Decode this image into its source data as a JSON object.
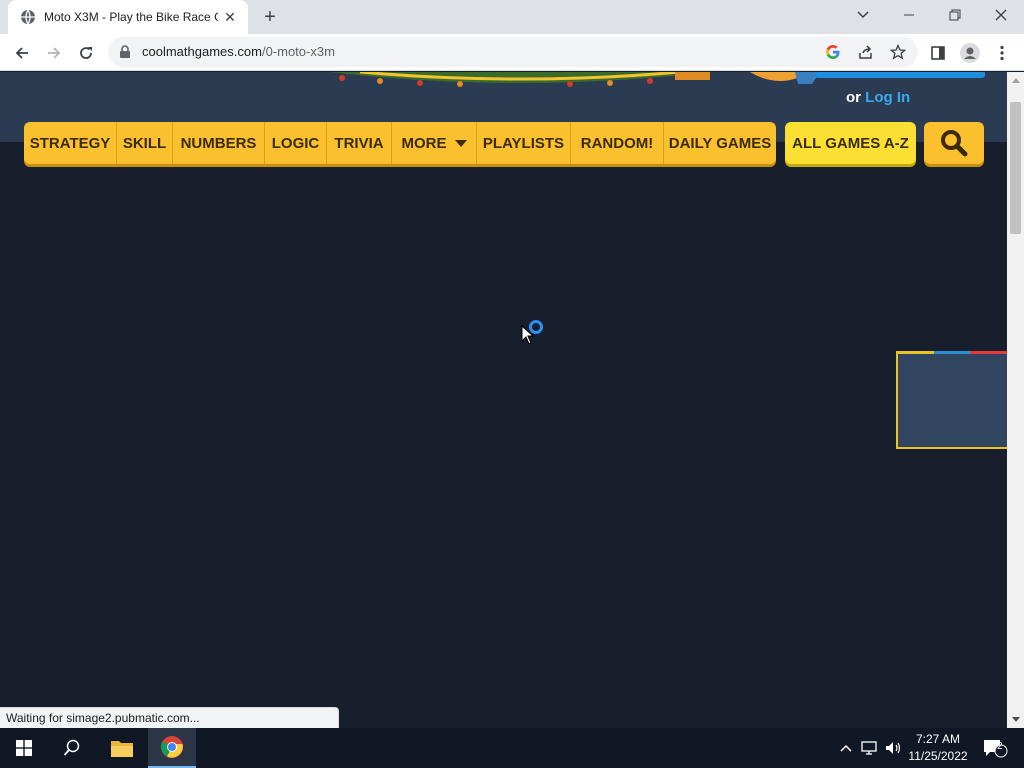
{
  "browser": {
    "tab_title": "Moto X3M - Play the Bike Race G",
    "url_domain": "coolmathgames.com",
    "url_path": "/0-moto-x3m",
    "status_text": "Waiting for simage2.pubmatic.com..."
  },
  "page": {
    "login_prefix": "or",
    "login_link": "Log In",
    "nav_items": [
      "STRATEGY",
      "SKILL",
      "NUMBERS",
      "LOGIC",
      "TRIVIA",
      "MORE",
      "PLAYLISTS",
      "RANDOM!",
      "DAILY GAMES"
    ],
    "az_button": "ALL GAMES A-Z",
    "nav_color": "#fbc02d",
    "header_color": "#2a3b52",
    "background_color": "#161f2b"
  },
  "taskbar": {
    "time": "7:27 AM",
    "date": "11/25/2022",
    "notification_count": "2"
  }
}
